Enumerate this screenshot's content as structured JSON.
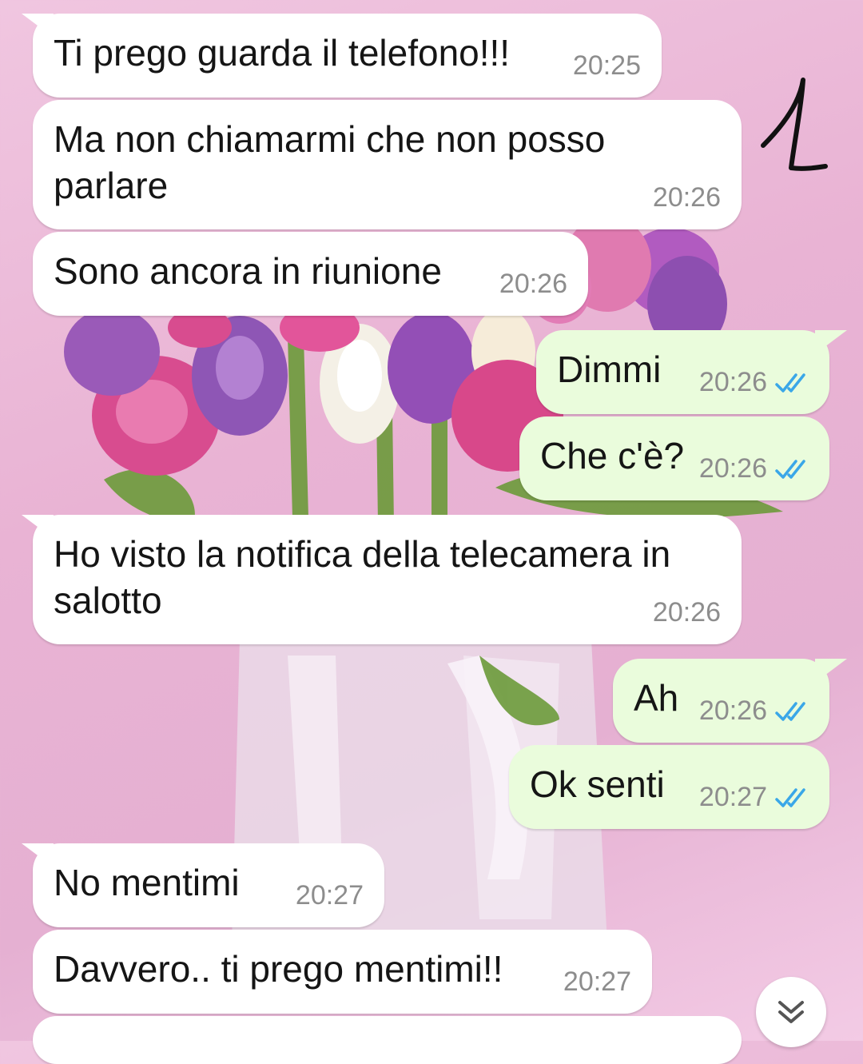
{
  "colors": {
    "incoming_bubble": "#ffffff",
    "outgoing_bubble": "#eafcdc",
    "timestamp": "#8d8d8d",
    "read_ticks": "#3aa7e8",
    "wallpaper": "#e9b3d4"
  },
  "annotation": {
    "handwritten_mark": "1"
  },
  "messages": [
    {
      "direction": "incoming",
      "text": "Ti prego guarda il telefono!!!",
      "time": "20:25"
    },
    {
      "direction": "incoming",
      "text": "Ma non chiamarmi che non posso\nparlare",
      "time": "20:26"
    },
    {
      "direction": "incoming",
      "text": "Sono ancora in riunione",
      "time": "20:26"
    },
    {
      "direction": "outgoing",
      "text": "Dimmi",
      "time": "20:26",
      "status": "read-double-check-icon"
    },
    {
      "direction": "outgoing",
      "text": "Che c'è?",
      "time": "20:26",
      "status": "read-double-check-icon"
    },
    {
      "direction": "incoming",
      "text": "Ho visto la notifica della telecamera in\nsalotto",
      "time": "20:26"
    },
    {
      "direction": "outgoing",
      "text": "Ah",
      "time": "20:26",
      "status": "read-double-check-icon"
    },
    {
      "direction": "outgoing",
      "text": "Ok senti",
      "time": "20:27",
      "status": "read-double-check-icon"
    },
    {
      "direction": "incoming",
      "text": "No mentimi",
      "time": "20:27"
    },
    {
      "direction": "incoming",
      "text": "Davvero.. ti prego mentimi!!",
      "time": "20:27"
    }
  ],
  "scroll_button": {
    "icon": "double-chevron-down-icon"
  }
}
